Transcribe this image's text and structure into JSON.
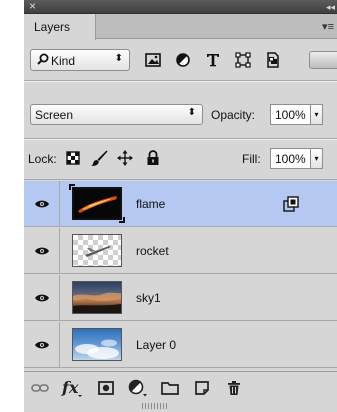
{
  "window": {
    "close_glyph": "×",
    "collapse_glyph": "◂◂"
  },
  "tabs": {
    "active_label": "Layers",
    "menu_glyph": "▾≡"
  },
  "filter": {
    "kind_label": "Kind",
    "kind_arrow": "⬍",
    "icons": [
      "image-filter-icon",
      "adjustment-filter-icon",
      "type-filter-icon",
      "shape-filter-icon",
      "smart-object-filter-icon"
    ]
  },
  "blending": {
    "mode": "Screen",
    "arrow": "⬍",
    "opacity_label": "Opacity:",
    "opacity_value": "100%",
    "dropdown_arrow": "▾"
  },
  "lock": {
    "label": "Lock:",
    "icons": [
      "lock-transparent-pixels-icon",
      "lock-image-pixels-icon",
      "lock-position-icon",
      "lock-all-icon"
    ],
    "fill_label": "Fill:",
    "fill_value": "100%",
    "dropdown_arrow": "▾"
  },
  "layers": [
    {
      "name": "flame",
      "selected": true,
      "visible": true,
      "smart_object": true
    },
    {
      "name": "rocket",
      "selected": false,
      "visible": true,
      "smart_object": false
    },
    {
      "name": "sky1",
      "selected": false,
      "visible": true,
      "smart_object": false
    },
    {
      "name": "Layer 0",
      "selected": false,
      "visible": true,
      "smart_object": false
    }
  ],
  "bottom_bar": {
    "icons": [
      "link-layers-icon",
      "fx-icon",
      "add-mask-icon",
      "new-adjustment-layer-icon",
      "new-group-icon",
      "new-layer-icon",
      "delete-layer-icon"
    ]
  },
  "colors": {
    "panel_bg": "#d6d6d6",
    "selected_row": "#b5c8f2"
  }
}
